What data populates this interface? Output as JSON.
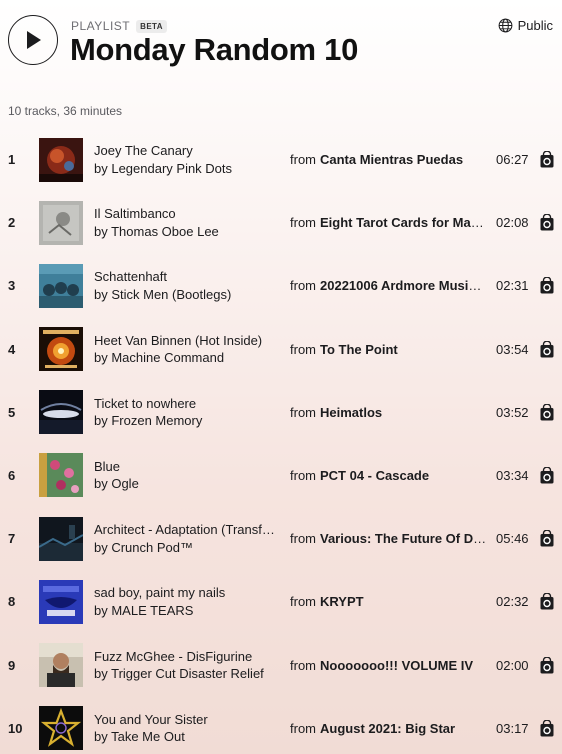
{
  "header": {
    "kicker": "PLAYLIST",
    "badge": "BETA",
    "title": "Monday Random 10",
    "visibility": "Public"
  },
  "summary": "10 tracks, 36 minutes",
  "from_label": "from",
  "tracks": [
    {
      "num": "1",
      "title": "Joey The Canary",
      "artist": "by Legendary Pink Dots",
      "album": "Canta Mientras Puedas",
      "duration": "06:27"
    },
    {
      "num": "2",
      "title": "Il Saltimbanco",
      "artist": "by Thomas Oboe Lee",
      "album": "Eight Tarot Cards for Mad…",
      "duration": "02:08"
    },
    {
      "num": "3",
      "title": "Schattenhaft",
      "artist": "by Stick Men (Bootlegs)",
      "album": "20221006 Ardmore Music …",
      "duration": "02:31"
    },
    {
      "num": "4",
      "title": "Heet Van Binnen (Hot Inside)",
      "artist": "by Machine Command",
      "album": "To The Point",
      "duration": "03:54"
    },
    {
      "num": "5",
      "title": "Ticket to nowhere",
      "artist": "by Frozen Memory",
      "album": "Heimatlos",
      "duration": "03:52"
    },
    {
      "num": "6",
      "title": "Blue",
      "artist": "by Ogle",
      "album": "PCT 04 - Cascade",
      "duration": "03:34"
    },
    {
      "num": "7",
      "title": "Architect - Adaptation (Transfo…",
      "artist": "by Crunch Pod™",
      "album": "Various: The Future Of Dr…",
      "duration": "05:46"
    },
    {
      "num": "8",
      "title": "sad boy, paint my nails",
      "artist": "by MALE TEARS",
      "album": "KRYPT",
      "duration": "02:32"
    },
    {
      "num": "9",
      "title": "Fuzz McGhee - DisFigurine",
      "artist": "by Trigger Cut Disaster Relief",
      "album": "Nooooooo!!! VOLUME IV",
      "duration": "02:00"
    },
    {
      "num": "10",
      "title": "You and Your Sister",
      "artist": "by Take Me Out",
      "album": "August 2021: Big Star",
      "duration": "03:17"
    }
  ]
}
